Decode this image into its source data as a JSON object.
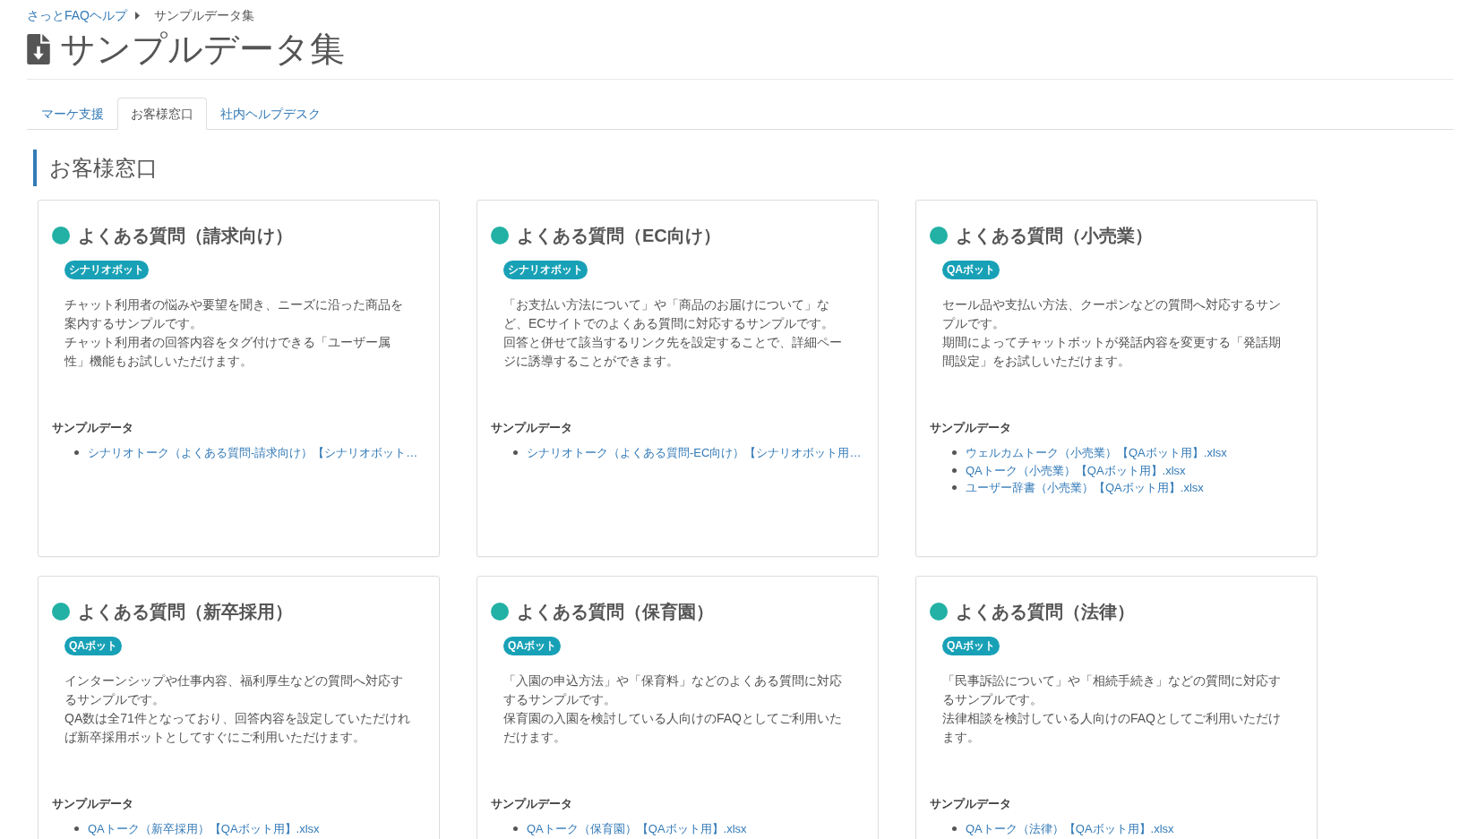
{
  "breadcrumb": {
    "items": [
      {
        "label": "さっとFAQヘルプ",
        "kind": "link"
      },
      {
        "label": "サンプルデータ集",
        "kind": "current"
      }
    ]
  },
  "page_title": "サンプルデータ集",
  "tabs": [
    {
      "label": "マーケ支援",
      "selected": false
    },
    {
      "label": "お客様窓口",
      "selected": true
    },
    {
      "label": "社内ヘルプデスク",
      "selected": false
    }
  ],
  "section": {
    "heading": "お客様窓口",
    "cards": [
      {
        "title": "よくある質問（請求向け）",
        "tag": "シナリオボット",
        "description": [
          "チャット利用者の悩みや要望を聞き、ニーズに沿った商品を案内するサンプルです。",
          "チャット利用者の回答内容をタグ付けできる「ユーザー属性」機能もお試しいただけます。"
        ],
        "files_label": "サンプルデータ",
        "files": [
          "シナリオトーク（よくある質問-請求向け）【シナリオボット…"
        ]
      },
      {
        "title": "よくある質問（EC向け）",
        "tag": "シナリオボット",
        "description": [
          "「お支払い方法について」や「商品のお届けについて」など、ECサイトでのよくある質問に対応するサンプルです。",
          "回答と併せて該当するリンク先を設定することで、詳細ページに誘導することができます。"
        ],
        "files_label": "サンプルデータ",
        "files": [
          "シナリオトーク（よくある質問-EC向け）【シナリオボット用…"
        ]
      },
      {
        "title": "よくある質問（小売業）",
        "tag": "QAボット",
        "description": [
          "セール品や支払い方法、クーポンなどの質問へ対応するサンプルです。",
          "期間によってチャットボットが発話内容を変更する「発話期間設定」をお試しいただけます。"
        ],
        "files_label": "サンプルデータ",
        "files": [
          "ウェルカムトーク（小売業）【QAボット用】.xlsx",
          "QAトーク（小売業）【QAボット用】.xlsx",
          "ユーザー辞書（小売業）【QAボット用】.xlsx"
        ]
      },
      {
        "title": "よくある質問（新卒採用）",
        "tag": "QAボット",
        "description": [
          "インターンシップや仕事内容、福利厚生などの質問へ対応するサンプルです。",
          "QA数は全71件となっており、回答内容を設定していただければ新卒採用ボットとしてすぐにご利用いただけます。"
        ],
        "files_label": "サンプルデータ",
        "files": [
          "QAトーク（新卒採用）【QAボット用】.xlsx"
        ]
      },
      {
        "title": "よくある質問（保育園）",
        "tag": "QAボット",
        "description": [
          "「入園の申込方法」や「保育料」などのよくある質問に対応するサンプルです。",
          "保育園の入園を検討している人向けのFAQとしてご利用いただけます。"
        ],
        "files_label": "サンプルデータ",
        "files": [
          "QAトーク（保育園）【QAボット用】.xlsx"
        ]
      },
      {
        "title": "よくある質問（法律）",
        "tag": "QAボット",
        "description": [
          "「民事訴訟について」や「相続手続き」などの質問に対応するサンプルです。",
          "法律相談を検討している人向けのFAQとしてご利用いただけます。"
        ],
        "files_label": "サンプルデータ",
        "files": [
          "QAトーク（法律）【QAボット用】.xlsx"
        ]
      }
    ]
  }
}
